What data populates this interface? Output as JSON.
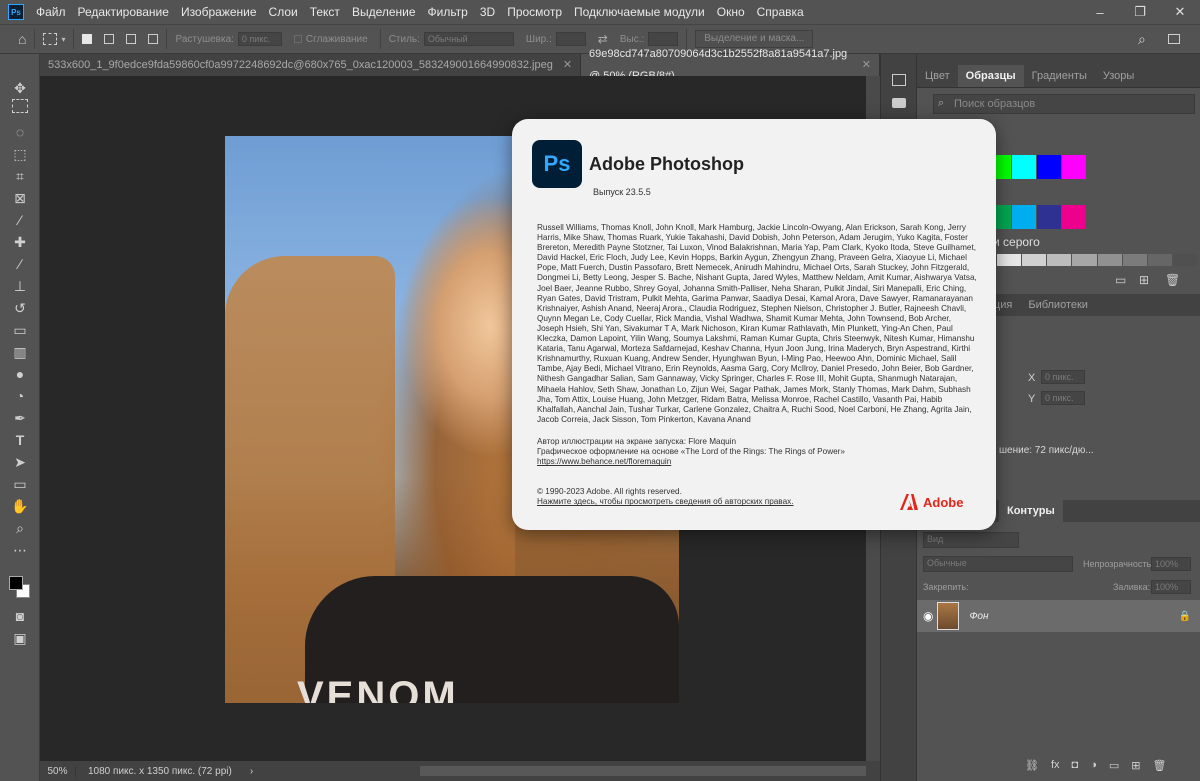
{
  "app": {
    "logo_text": "Ps",
    "menu": [
      "Файл",
      "Редактирование",
      "Изображение",
      "Слои",
      "Текст",
      "Выделение",
      "Фильтр",
      "3D",
      "Просмотр",
      "Подключаемые модули",
      "Окно",
      "Справка"
    ],
    "window_controls": [
      "–",
      "❐",
      "✕"
    ]
  },
  "options": {
    "feather_label": "Растушевка:",
    "feather_value": "0 пикс.",
    "antialias_label": "Сглаживание",
    "style_label": "Стиль:",
    "style_value": "Обычный",
    "width_label": "Шир.:",
    "height_label": "Выс.:",
    "select_mask_button": "Выделение и маска..."
  },
  "tabs": [
    {
      "label": "533x600_1_9f0edce9fda59860cf0a9972248692dc@680x765_0xac120003_583249001664990832.jpeg",
      "close": "✕"
    },
    {
      "label": "69e98cd747a80709064d3c1b2552f8a81a9541a7.jpg @ 50% (RGB/8#)",
      "close": "✕"
    }
  ],
  "canvas": {
    "shirt_text": "VENOM"
  },
  "status": {
    "zoom": "50%",
    "doc_info": "1080 пикс. x 1350 пикс. (72 ppi)",
    "arrow": "›"
  },
  "panels": {
    "tabs": [
      "Цвет",
      "Образцы",
      "Градиенты",
      "Узоры"
    ],
    "search_placeholder": "Поиск образцов",
    "gray_label": "и серого",
    "prop_tabs": [
      "екция",
      "Библиотеки"
    ],
    "props": {
      "x_label": "X",
      "y_label": "Y",
      "x_value": "0 пикс.",
      "y_value": "0 пикс.",
      "resolution": "шение: 72 пикс/дю..."
    },
    "layers_tabs": [
      "Контуры"
    ],
    "kind_placeholder": "Вид",
    "blend_mode": "Обычные",
    "opacity_label": "Непрозрачность:",
    "opacity_value": "100%",
    "lock_label": "Закрепить:",
    "fill_label": "Заливка:",
    "fill_value": "100%",
    "layer_name": "Фон"
  },
  "about": {
    "product": "Adobe Photoshop",
    "version": "Выпуск 23.5.5",
    "credits": "Russell Williams, Thomas Knoll, John Knoll, Mark Hamburg, Jackie Lincoln-Owyang, Alan Erickson, Sarah Kong, Jerry Harris, Mike Shaw, Thomas Ruark, Yukie Takahashi, David Dobish, John Peterson, Adam Jerugim, Yuko Kagita, Foster Brereton, Meredith Payne Stotzner, Tai Luxon, Vinod Balakrishnan, Maria Yap, Pam Clark, Kyoko Itoda, Steve Guilhamet, David Hackel, Eric Floch, Judy Lee, Kevin Hopps, Barkin Aygun, Zhengyun Zhang, Praveen Gelra, Xiaoyue Li, Michael Pope, Matt Fuerch, Dustin Passofaro, Brett Nemecek, Anirudh Mahindru, Michael Orts, Sarah Stuckey, John Fitzgerald, Dongmei Li, Betty Leong, Jesper S. Bache, Nishant Gupta, Jared Wyles, Matthew Neldam, Amit Kumar, Aishwarya Vatsa, Joel Baer, Jeanne Rubbo, Shrey Goyal, Johanna Smith-Palliser, Neha Sharan, Pulkit Jindal, Siri Manepalli, Eric Ching, Ryan Gates, David Tristram, Pulkit Mehta, Garima Panwar, Saadiya Desai, Kamal Arora, Dave Sawyer, Ramanarayanan Krishnaiyer, Ashish Anand, Neeraj Arora., Claudia Rodriguez, Stephen Nielson, Christopher J. Butler, Rajneesh Chavli, Quynn Megan Le, Cody Cuellar, Rick Mandia, Vishal Wadhwa, Shamit Kumar Mehta, John Townsend, Bob Archer, Joseph Hsieh, Shi Yan, Sivakumar T A, Mark Nichoson, Kiran Kumar Rathlavath, Min Plunkett, Ying-An Chen, Paul Kleczka, Damon Lapoint, Yilin Wang, Soumya Lakshmi, Raman Kumar Gupta, Chris Steenwyk, Nitesh Kumar, Himanshu Kataria, Tanu Agarwal, Morteza Safdarnejad, Keshav Channa, Hyun Joon Jung, Irina Maderych, Bryn Aspestrand, Kirthi Krishnamurthy, Ruxuan Kuang, Andrew Sender, Hyunghwan Byun, I-Ming Pao, Heewoo Ahn, Dominic Michael, Salil Tambe, Ajay Bedi, Michael Vitrano, Erin Reynolds, Aasma Garg, Cory McIlroy, Daniel Presedo, John Beier, Bob Gardner, Nithesh Gangadhar Salian, Sam Gannaway, Vicky Springer, Charles F. Rose III, Mohit Gupta, Shanmugh Natarajan, Mihaela Hahlov, Seth Shaw, Jonathan Lo, Zijun Wei, Sagar Pathak, James Mork, Stanly Thomas, Mark Dahm, Subhash Jha, Tom Attix, Louise Huang, John Metzger, Ridam Batra, Melissa Monroe, Rachel Castillo, Vasanth Pai, Habib Khalfallah, Aanchal Jain, Tushar Turkar, Carlene Gonzalez, Chaitra A, Ruchi Sood, Noel Carboni, He Zhang, Agrita Jain, Jacob Correia, Jack Sisson, Tom Pinkerton, Kavana Anand",
    "art_author": "Автор иллюстрации на экране запуска: Flore Maquin",
    "art_based": "Графическое оформление на основе «The Lord of the Rings: The Rings of Power»",
    "art_link": "https://www.behance.net/floremaquin",
    "copyright": "© 1990-2023 Adobe. All rights reserved.",
    "legal_link": "Нажмите здесь, чтобы просмотреть сведения об авторских правах.",
    "adobe_text": "Adobe"
  },
  "colors": {
    "accent": "#31a8ff",
    "adobe_red": "#e1251b",
    "swatches_row1": [
      "#00ff00",
      "#00ffff",
      "#0000ff",
      "#ff00ff"
    ],
    "swatches_row2": [
      "#00a651",
      "#00aeef",
      "#2e3192",
      "#ec008c"
    ]
  }
}
